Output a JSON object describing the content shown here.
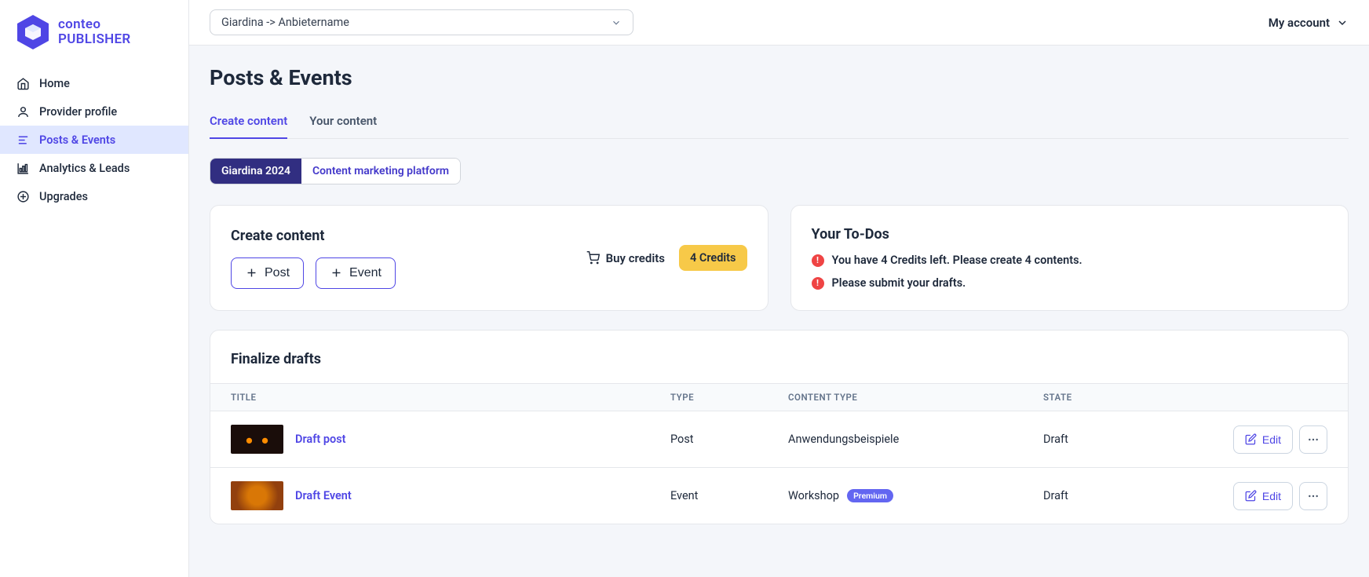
{
  "brand": {
    "line1": "conteo",
    "line2": "PUBLISHER"
  },
  "nav": {
    "home": "Home",
    "provider": "Provider profile",
    "posts": "Posts & Events",
    "analytics": "Analytics & Leads",
    "upgrades": "Upgrades"
  },
  "header": {
    "selector": "Giardina -> Anbietername",
    "account": "My account"
  },
  "page": {
    "title": "Posts & Events"
  },
  "tabs": {
    "create": "Create content",
    "your": "Your content"
  },
  "pills": {
    "giardina": "Giardina 2024",
    "platform": "Content marketing platform"
  },
  "create_card": {
    "title": "Create content",
    "post_btn": "Post",
    "event_btn": "Event",
    "buy_credits": "Buy credits",
    "credit_badge": "4 Credits"
  },
  "todos": {
    "title": "Your To-Dos",
    "item1": "You have 4 Credits left. Please create 4 contents.",
    "item2": "Please submit your drafts."
  },
  "drafts": {
    "title": "Finalize drafts",
    "columns": {
      "title": "TITLE",
      "type": "TYPE",
      "content_type": "CONTENT TYPE",
      "state": "STATE"
    },
    "rows": [
      {
        "title": "Draft post",
        "type": "Post",
        "content_type": "Anwendungsbeispiele",
        "premium": false,
        "state": "Draft"
      },
      {
        "title": "Draft Event",
        "type": "Event",
        "content_type": "Workshop",
        "premium": true,
        "premium_label": "Premium",
        "state": "Draft"
      }
    ],
    "edit_label": "Edit"
  }
}
